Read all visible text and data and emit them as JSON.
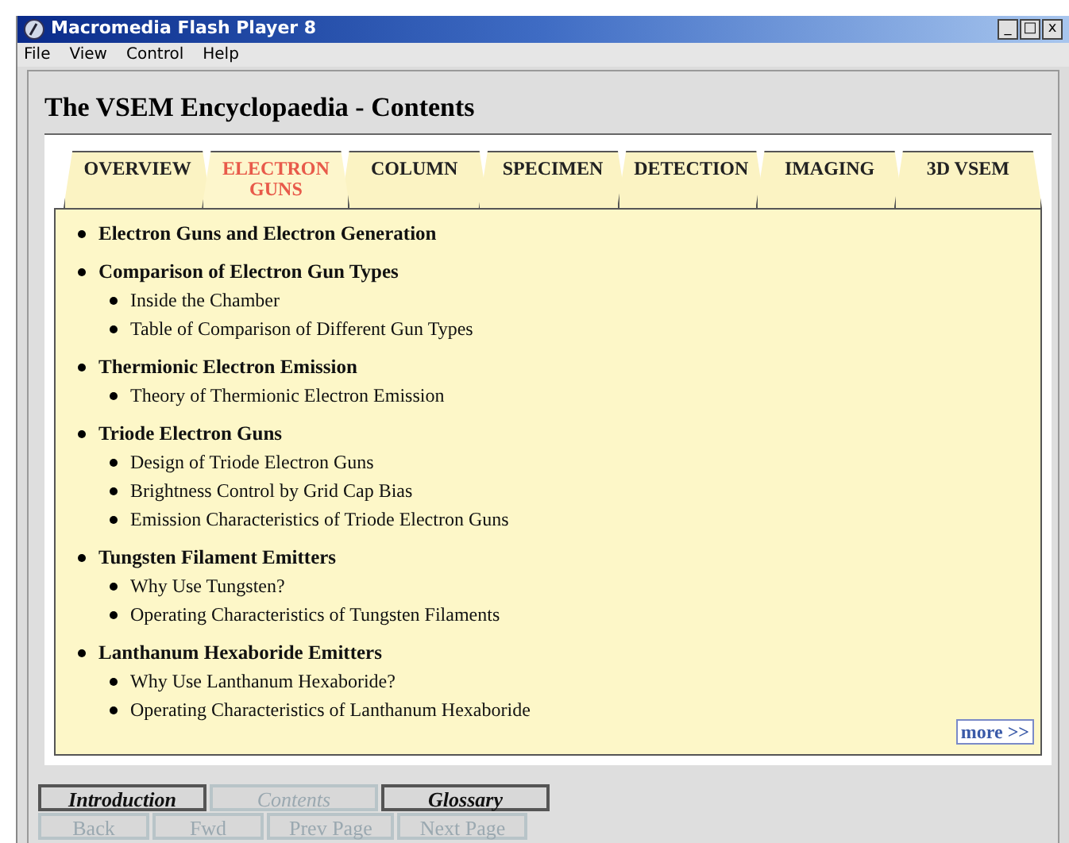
{
  "window": {
    "title": "Macromedia Flash Player 8",
    "controls": [
      "_",
      "□",
      "x"
    ]
  },
  "menu": [
    "File",
    "View",
    "Control",
    "Help"
  ],
  "page_title": "The VSEM Encyclopaedia - Contents",
  "tabs": [
    {
      "label": "OVERVIEW",
      "selected": false
    },
    {
      "label": "ELECTRON GUNS",
      "selected": true
    },
    {
      "label": "COLUMN",
      "selected": false
    },
    {
      "label": "SPECIMEN",
      "selected": false
    },
    {
      "label": "DETECTION",
      "selected": false
    },
    {
      "label": "IMAGING",
      "selected": false
    },
    {
      "label": "3D VSEM",
      "selected": false
    }
  ],
  "sections": [
    {
      "title": "Electron Guns and Electron Generation"
    },
    {
      "title": "Comparison of Electron Gun Types",
      "children": [
        "Inside the Chamber",
        "Table of Comparison of Different Gun Types"
      ]
    },
    {
      "title": "Thermionic Electron Emission",
      "children": [
        "Theory of Thermionic Electron Emission"
      ]
    },
    {
      "title": "Triode Electron Guns",
      "children": [
        "Design of Triode Electron Guns",
        "Brightness Control by Grid Cap Bias",
        "Emission Characteristics of Triode Electron Guns"
      ]
    },
    {
      "title": "Tungsten Filament Emitters",
      "children": [
        "Why Use Tungsten?",
        "Operating Characteristics of Tungsten Filaments"
      ]
    },
    {
      "title": "Lanthanum Hexaboride Emitters",
      "children": [
        "Why Use Lanthanum Hexaboride?",
        "Operating Characteristics of Lanthanum Hexaboride"
      ]
    }
  ],
  "more_link": "more >>",
  "nav_rows": [
    [
      {
        "label": "Introduction",
        "disabled": false
      },
      {
        "label": "Contents",
        "disabled": true
      },
      {
        "label": "Glossary",
        "disabled": false
      }
    ],
    [
      {
        "label": "Back",
        "disabled": true
      },
      {
        "label": "Fwd",
        "disabled": true
      },
      {
        "label": "Prev Page",
        "disabled": true
      },
      {
        "label": "Next Page",
        "disabled": true
      }
    ]
  ]
}
